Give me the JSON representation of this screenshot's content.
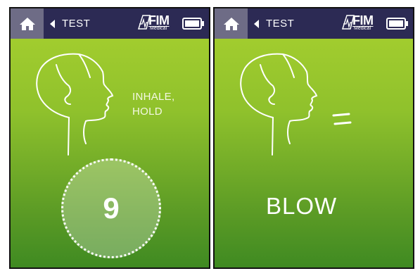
{
  "screens": [
    {
      "nav": {
        "back_label": "TEST",
        "logo_text": "FIM",
        "logo_sub": "Medical"
      },
      "instruction": {
        "line1": "INHALE,",
        "line2": "HOLD"
      },
      "counter": {
        "value": "9"
      }
    },
    {
      "nav": {
        "back_label": "TEST",
        "logo_text": "FIM",
        "logo_sub": "Medical"
      },
      "instruction": {
        "text": "BLOW"
      }
    }
  ],
  "icons": {
    "home": "home-icon",
    "back": "caret-left-icon",
    "battery": "battery-icon",
    "head": "head-profile-icon",
    "breath": "breath-lines-icon"
  },
  "colors": {
    "nav_bg": "#2c2a54",
    "home_bg": "#6e6c86",
    "screen_top": "#a9d12f",
    "screen_bottom": "#3f8a22",
    "text": "#ffffff"
  }
}
